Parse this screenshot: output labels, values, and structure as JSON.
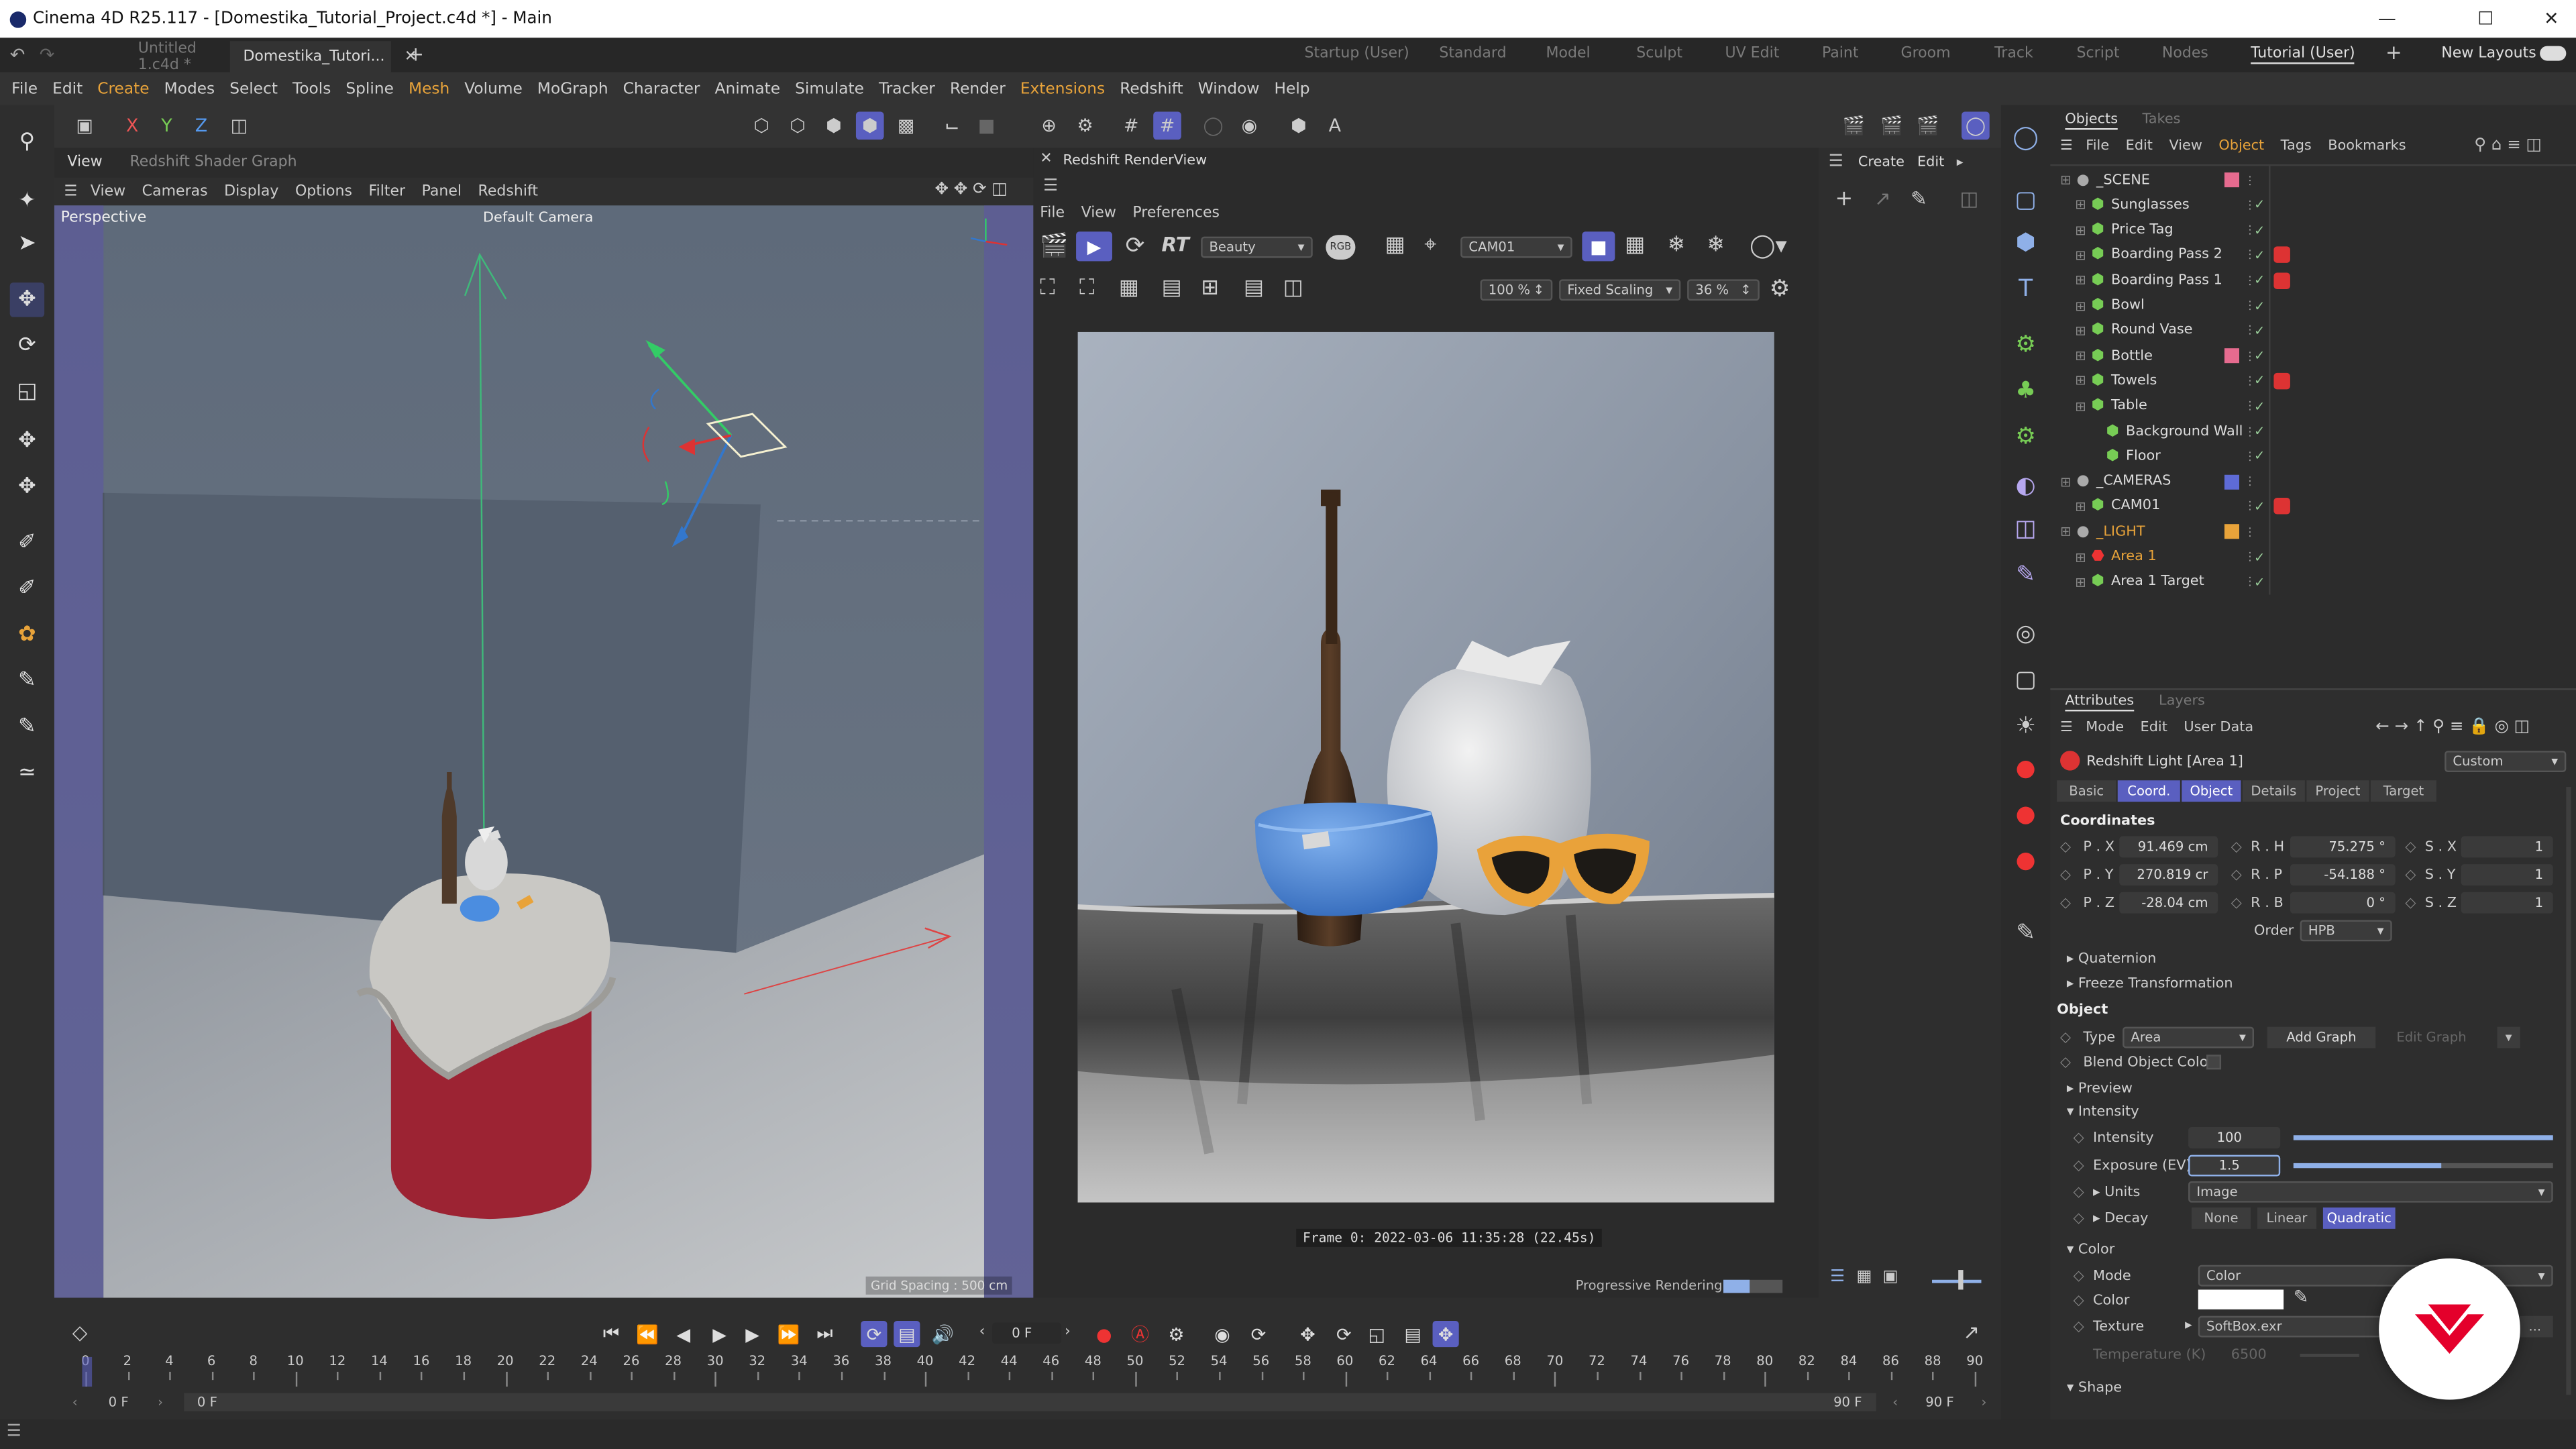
{
  "title": "Cinema 4D R25.117 - [Domestika_Tutorial_Project.c4d *] - Main",
  "doc_tabs": [
    "Untitled 1.c4d *",
    "Domestika_Tutori..."
  ],
  "layouts": [
    "Startup (User)",
    "Standard",
    "Model",
    "Sculpt",
    "UV Edit",
    "Paint",
    "Groom",
    "Track",
    "Script",
    "Nodes",
    "Tutorial (User)"
  ],
  "new_layouts": "New Layouts",
  "menu": [
    "File",
    "Edit",
    "Create",
    "Modes",
    "Select",
    "Tools",
    "Spline",
    "Mesh",
    "Volume",
    "MoGraph",
    "Character",
    "Animate",
    "Simulate",
    "Tracker",
    "Render",
    "Extensions",
    "Redshift",
    "Window",
    "Help"
  ],
  "axis_labels": [
    "X",
    "Y",
    "Z"
  ],
  "viewport": {
    "tabs": [
      "View",
      "Redshift Shader Graph"
    ],
    "menu": [
      "View",
      "Cameras",
      "Display",
      "Options",
      "Filter",
      "Panel",
      "Redshift"
    ],
    "name": "Perspective",
    "camera": "Default Camera",
    "grid": "Grid Spacing : 500 cm"
  },
  "renderview": {
    "title": "Redshift RenderView",
    "menu": [
      "File",
      "View",
      "Preferences"
    ],
    "aov": "Beauty",
    "rgb": "RGB",
    "rt": "RT",
    "camera": "CAM01",
    "zoom": "100 %",
    "scaling": "Fixed Scaling",
    "scale_pct": "36 %",
    "frame_info": "Frame  0:  2022-03-06  11:35:28  (22.45s)",
    "status": "Progressive Rendering...",
    "progress": 0.45
  },
  "side_panel": {
    "menu": [
      "Create",
      "Edit"
    ]
  },
  "objects": {
    "tabs": [
      "Objects",
      "Takes"
    ],
    "menu": [
      "File",
      "Edit",
      "View",
      "Object",
      "Tags",
      "Bookmarks"
    ],
    "rows": [
      {
        "name": "_SCENE",
        "indent": 0,
        "color": "#e66b8f"
      },
      {
        "name": "Sunglasses",
        "indent": 1
      },
      {
        "name": "Price Tag",
        "indent": 1
      },
      {
        "name": "Boarding Pass 2",
        "indent": 1,
        "tag": "red"
      },
      {
        "name": "Boarding Pass 1",
        "indent": 1,
        "tag": "red"
      },
      {
        "name": "Bowl",
        "indent": 1
      },
      {
        "name": "Round Vase",
        "indent": 1
      },
      {
        "name": "Bottle",
        "indent": 1,
        "color": "#e66b8f"
      },
      {
        "name": "Towels",
        "indent": 1,
        "tag": "red"
      },
      {
        "name": "Table",
        "indent": 1
      },
      {
        "name": "Background Wall",
        "indent": 2
      },
      {
        "name": "Floor",
        "indent": 2
      },
      {
        "name": "_CAMERAS",
        "indent": 0,
        "color": "#5e6bd6"
      },
      {
        "name": "CAM01",
        "indent": 1,
        "tag": "red"
      },
      {
        "name": "_LIGHT",
        "indent": 0,
        "color": "#e8a33a",
        "orange": true
      },
      {
        "name": "Area 1",
        "indent": 1,
        "orange": true
      },
      {
        "name": "Area 1 Target",
        "indent": 1
      }
    ]
  },
  "attributes": {
    "tabs": [
      "Attributes",
      "Layers"
    ],
    "menu": [
      "Mode",
      "Edit",
      "User Data"
    ],
    "object_label": "Redshift Light [Area 1]",
    "preset": "Custom",
    "subtabs": [
      "Basic",
      "Coord.",
      "Object",
      "Details",
      "Project",
      "Target"
    ],
    "coords_header": "Coordinates",
    "coords": [
      {
        "p": "P . X",
        "pv": "91.469 cm",
        "r": "R . H",
        "rv": "75.275 °",
        "s": "S . X",
        "sv": "1"
      },
      {
        "p": "P . Y",
        "pv": "270.819 cr",
        "r": "R . P",
        "rv": "-54.188 °",
        "s": "S . Y",
        "sv": "1"
      },
      {
        "p": "P . Z",
        "pv": "-28.04 cm",
        "r": "R . B",
        "rv": "0 °",
        "s": "S . Z",
        "sv": "1"
      }
    ],
    "order_label": "Order",
    "order": "HPB",
    "quaternion": "Quaternion",
    "freeze": "Freeze Transformation",
    "object_header": "Object",
    "type_label": "Type",
    "type": "Area",
    "add_graph": "Add Graph",
    "edit_graph": "Edit Graph",
    "blend": "Blend Object Color",
    "preview": "Preview",
    "intensity_header": "Intensity",
    "intensity_label": "Intensity",
    "intensity": "100",
    "exposure_label": "Exposure (EV)",
    "exposure": "1.5",
    "units_label": "Units",
    "units": "Image",
    "decay_label": "Decay",
    "decay_opts": [
      "None",
      "Linear",
      "Quadratic"
    ],
    "color_header": "Color",
    "mode_label": "Mode",
    "mode": "Color",
    "color_label": "Color",
    "texture_label": "Texture",
    "texture": "SoftBox.exr",
    "temp_label": "Temperature (K)",
    "temp": "6500",
    "shape": "Shape"
  },
  "timeline": {
    "frame": "0 F",
    "ticks": [
      "0",
      "2",
      "4",
      "6",
      "8",
      "10",
      "12",
      "14",
      "16",
      "18",
      "20",
      "22",
      "24",
      "26",
      "28",
      "30",
      "32",
      "34",
      "36",
      "38",
      "40",
      "42",
      "44",
      "46",
      "48",
      "50",
      "52",
      "54",
      "56",
      "58",
      "60",
      "62",
      "64",
      "66",
      "68",
      "70",
      "72",
      "74",
      "76",
      "78",
      "80",
      "82",
      "84",
      "86",
      "88",
      "90"
    ],
    "start": "0 F",
    "start2": "0 F",
    "end": "90 F",
    "end2": "90 F"
  }
}
